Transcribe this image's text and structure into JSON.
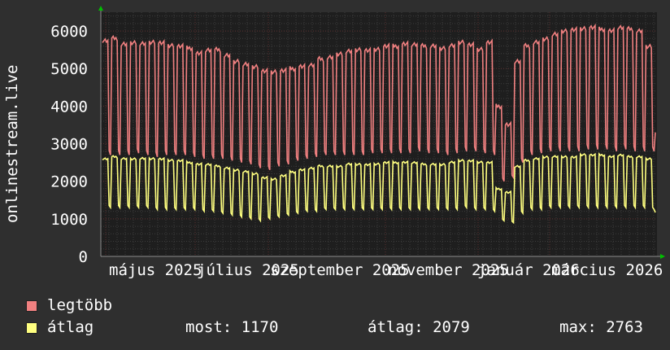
{
  "chart_data": {
    "type": "line",
    "ylabel": "onlinestream.live",
    "ylim": [
      0,
      6500
    ],
    "yticks": [
      0,
      1000,
      2000,
      3000,
      4000,
      5000,
      6000
    ],
    "x_tick_labels": [
      "május 2025",
      "július 2025",
      "szeptember 2025",
      "november 2025",
      "január 2026",
      "március 2026"
    ],
    "x_range": [
      "2025-03-27",
      "2026-03-26"
    ],
    "grid": true,
    "colors": {
      "background": "#2f2f2f",
      "plot_background": "#1e1e1e",
      "grid_major": "#5a2d2d",
      "grid_minor": "#3c3c3c",
      "axis": "#8c8c8c",
      "arrow": "#00c000"
    },
    "series": [
      {
        "name": "legtöbb",
        "color": "#f08080",
        "weekly_peak": [
          5750,
          5800,
          5650,
          5700,
          5650,
          5700,
          5700,
          5600,
          5600,
          5550,
          5400,
          5500,
          5500,
          5350,
          5200,
          5100,
          5050,
          4950,
          4900,
          4950,
          5000,
          5050,
          5100,
          5250,
          5300,
          5400,
          5450,
          5500,
          5500,
          5500,
          5600,
          5600,
          5650,
          5650,
          5600,
          5600,
          5550,
          5600,
          5700,
          5650,
          5500,
          5700,
          4000,
          3500,
          5200,
          5600,
          5700,
          5800,
          5900,
          6000,
          6050,
          6050,
          6100,
          6050,
          6000,
          6100,
          6050,
          6000,
          5600
        ],
        "weekly_low": [
          2700,
          2700,
          2700,
          2750,
          2700,
          2650,
          2700,
          2700,
          2700,
          2650,
          2600,
          2600,
          2600,
          2550,
          2500,
          2450,
          2350,
          2300,
          2400,
          2450,
          2550,
          2600,
          2650,
          2700,
          2700,
          2700,
          2700,
          2700,
          2750,
          2750,
          2750,
          2750,
          2750,
          2800,
          2750,
          2750,
          2700,
          2750,
          2800,
          2800,
          2750,
          2700,
          2000,
          2100,
          2500,
          2700,
          2750,
          2800,
          2800,
          2800,
          2800,
          2850,
          2850,
          2850,
          2800,
          2850,
          2800,
          2800,
          2800
        ],
        "last": 3300
      },
      {
        "name": "átlag",
        "color": "#ffff80",
        "weekly_peak": [
          2600,
          2650,
          2600,
          2600,
          2600,
          2600,
          2600,
          2550,
          2550,
          2500,
          2450,
          2450,
          2400,
          2350,
          2300,
          2250,
          2200,
          2100,
          2050,
          2150,
          2250,
          2300,
          2350,
          2400,
          2400,
          2400,
          2450,
          2450,
          2450,
          2450,
          2500,
          2500,
          2500,
          2500,
          2450,
          2450,
          2450,
          2500,
          2550,
          2550,
          2500,
          2500,
          1800,
          1700,
          2400,
          2550,
          2600,
          2650,
          2650,
          2650,
          2650,
          2700,
          2700,
          2700,
          2650,
          2700,
          2650,
          2650,
          2600
        ],
        "weekly_low": [
          1300,
          1300,
          1300,
          1300,
          1300,
          1250,
          1250,
          1250,
          1250,
          1250,
          1200,
          1200,
          1150,
          1100,
          1050,
          1000,
          950,
          1000,
          1050,
          1100,
          1150,
          1200,
          1200,
          1250,
          1250,
          1250,
          1250,
          1250,
          1250,
          1250,
          1250,
          1250,
          1250,
          1250,
          1250,
          1250,
          1250,
          1250,
          1300,
          1250,
          1250,
          1200,
          950,
          900,
          1150,
          1250,
          1250,
          1300,
          1300,
          1300,
          1300,
          1300,
          1300,
          1300,
          1300,
          1300,
          1300,
          1300,
          1250
        ],
        "last": 1170
      }
    ]
  },
  "legend": {
    "items": [
      {
        "label": "legtöbb",
        "color": "#f08080"
      },
      {
        "label": "átlag",
        "color": "#ffff80"
      }
    ],
    "stats": {
      "most": "most: 1170",
      "atlag": "átlag: 2079",
      "max": "max: 2763"
    }
  }
}
